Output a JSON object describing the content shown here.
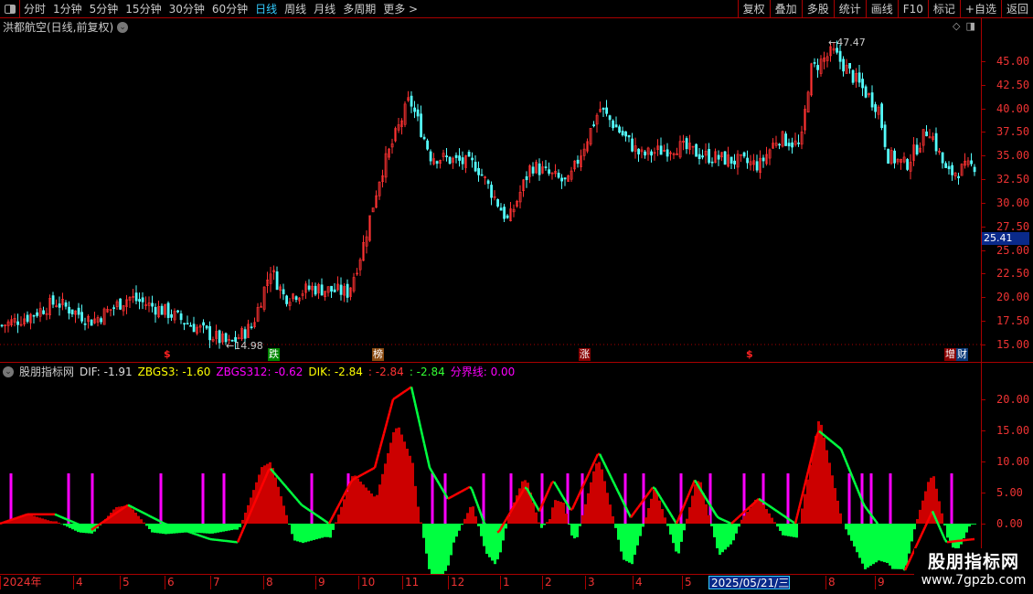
{
  "toolbar": {
    "periods": [
      "分时",
      "1分钟",
      "5分钟",
      "15分钟",
      "30分钟",
      "60分钟",
      "日线",
      "周线",
      "月线",
      "多周期",
      "更多 >"
    ],
    "active": "日线",
    "buttons": [
      "复权",
      "叠加",
      "多股",
      "统计",
      "画线",
      "F10",
      "标记",
      "+自选",
      "返回"
    ]
  },
  "chart": {
    "title": "洪都航空(日线,前复权)",
    "high_label": "47.47",
    "low_label": "14.98",
    "current_price": "25.41",
    "y_labels": [
      "45.00",
      "42.50",
      "40.00",
      "37.50",
      "35.00",
      "32.50",
      "30.00",
      "27.50",
      "25.00",
      "22.50",
      "20.00",
      "17.50",
      "15.00"
    ],
    "markers": [
      {
        "text": "$",
        "kind": "dollar"
      },
      {
        "text": "跌",
        "kind": "green"
      },
      {
        "text": "榜",
        "kind": "brown"
      },
      {
        "text": "涨",
        "kind": "red"
      },
      {
        "text": "$",
        "kind": "dollar"
      },
      {
        "text": "增",
        "kind": "red"
      },
      {
        "text": "财",
        "kind": "blue"
      }
    ],
    "price_path": [
      [
        0,
        17
      ],
      [
        30,
        18
      ],
      [
        60,
        19.5
      ],
      [
        100,
        17.5
      ],
      [
        140,
        20
      ],
      [
        180,
        18.5
      ],
      [
        250,
        15
      ],
      [
        275,
        17
      ],
      [
        295,
        23
      ],
      [
        310,
        20
      ],
      [
        340,
        21
      ],
      [
        380,
        20.5
      ],
      [
        395,
        25
      ],
      [
        415,
        33
      ],
      [
        447,
        41
      ],
      [
        470,
        35
      ],
      [
        520,
        34
      ],
      [
        555,
        28
      ],
      [
        580,
        34
      ],
      [
        620,
        32
      ],
      [
        655,
        40
      ],
      [
        700,
        35
      ],
      [
        740,
        36
      ],
      [
        770,
        35
      ],
      [
        830,
        34
      ],
      [
        850,
        37
      ],
      [
        875,
        36
      ],
      [
        885,
        44
      ],
      [
        910,
        46
      ],
      [
        960,
        40
      ],
      [
        970,
        35
      ],
      [
        990,
        34
      ],
      [
        1015,
        38
      ],
      [
        1035,
        33
      ],
      [
        1065,
        34
      ]
    ]
  },
  "indicator": {
    "name": "股朋指标网",
    "dif": "DIF: -1.91",
    "zbgs3": "ZBGS3: -1.60",
    "zbgs312": "ZBGS312: -0.62",
    "dik": "DIK: -2.84",
    "red_val": ": -2.84",
    "green_val": ": -2.84",
    "boundary": "分界线: 0.00",
    "y_labels": [
      "20.00",
      "15.00",
      "10.00",
      "5.00",
      "0.00"
    ],
    "line_path": [
      [
        0,
        0
      ],
      [
        30,
        1.5
      ],
      [
        60,
        1.5
      ],
      [
        100,
        -1
      ],
      [
        140,
        3
      ],
      [
        180,
        0
      ],
      [
        230,
        -2.5
      ],
      [
        260,
        -3
      ],
      [
        295,
        9
      ],
      [
        330,
        3
      ],
      [
        360,
        0
      ],
      [
        385,
        7
      ],
      [
        410,
        9
      ],
      [
        430,
        20
      ],
      [
        450,
        22
      ],
      [
        470,
        9
      ],
      [
        490,
        4
      ],
      [
        515,
        6
      ],
      [
        530,
        0
      ],
      [
        545,
        -1.5
      ],
      [
        575,
        6
      ],
      [
        590,
        2
      ],
      [
        605,
        7
      ],
      [
        625,
        2
      ],
      [
        655,
        11.5
      ],
      [
        690,
        1
      ],
      [
        715,
        6
      ],
      [
        740,
        0
      ],
      [
        760,
        7
      ],
      [
        785,
        1
      ],
      [
        800,
        0
      ],
      [
        830,
        4
      ],
      [
        850,
        2
      ],
      [
        870,
        0
      ],
      [
        895,
        15
      ],
      [
        920,
        12
      ],
      [
        945,
        3
      ],
      [
        960,
        0
      ],
      [
        975,
        -5
      ],
      [
        990,
        -7.5
      ],
      [
        1020,
        2
      ],
      [
        1035,
        -3
      ],
      [
        1065,
        -2.5
      ]
    ],
    "signals": [
      12,
      75,
      101,
      176,
      222,
      245,
      291,
      341,
      381,
      473,
      487,
      529,
      559,
      593,
      621,
      637,
      684,
      704,
      745,
      777,
      814,
      835,
      862,
      929,
      943,
      953,
      974,
      1041
    ]
  },
  "dateaxis": {
    "labels": [
      "2024年",
      "4",
      "5",
      "6",
      "7",
      "8",
      "9",
      "10",
      "11",
      "12",
      "1",
      "2",
      "3",
      "4",
      "5",
      "2025/05/21/三",
      "8",
      "9"
    ]
  },
  "watermark": {
    "title": "股朋指标网",
    "url": "www.7gpzb.com"
  },
  "colors": {
    "up": "#ff3232",
    "down": "#54fcfc",
    "green": "#00ff40",
    "magenta": "#ff00ff",
    "axis": "#aa0000"
  }
}
